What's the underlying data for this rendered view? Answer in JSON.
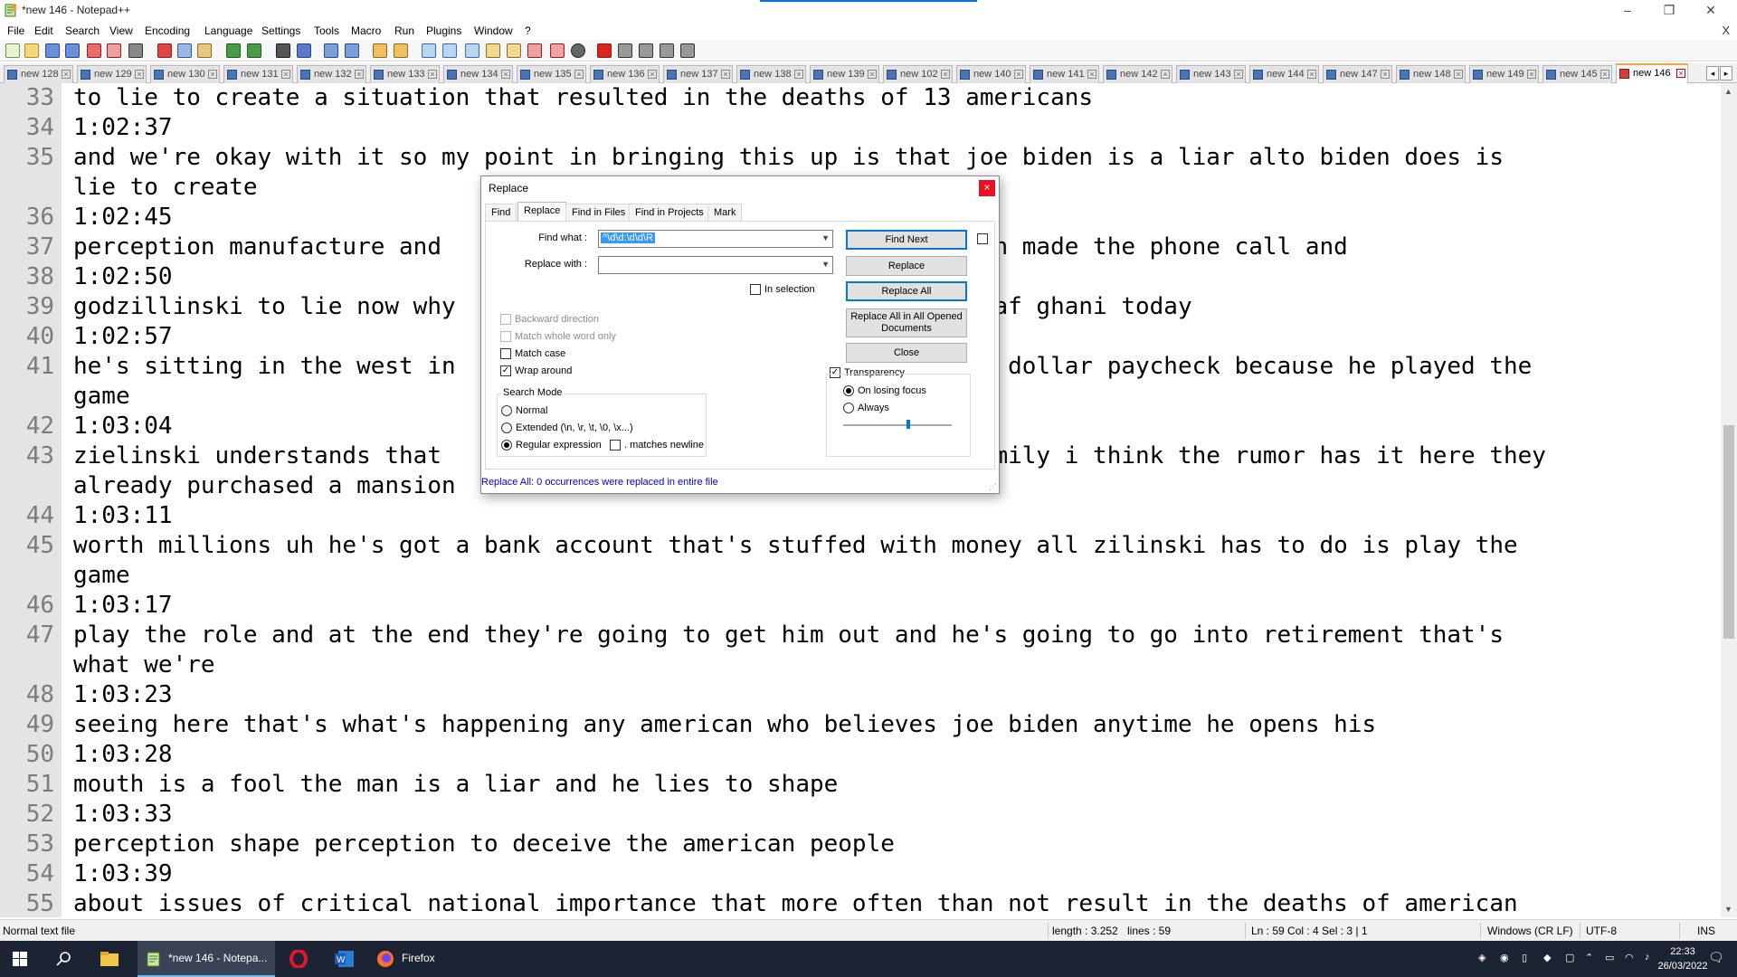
{
  "window": {
    "title": "*new 146 - Notepad++"
  },
  "menu": [
    "File",
    "Edit",
    "Search",
    "View",
    "Encoding",
    "Language",
    "Settings",
    "Tools",
    "Macro",
    "Run",
    "Plugins",
    "Window",
    "?"
  ],
  "menu_close": "X",
  "tabs": [
    "new 128",
    "new 129",
    "new 130",
    "new 131",
    "new 132",
    "new 133",
    "new 134",
    "new 135",
    "new 136",
    "new 137",
    "new 138",
    "new 139",
    "new 102",
    "new 140",
    "new 141",
    "new 142",
    "new 143",
    "new 144",
    "new 147",
    "new 148",
    "new 149",
    "new 145",
    "new 146"
  ],
  "active_tab": "new 146",
  "editor_lines": [
    {
      "num": "33",
      "text": "to lie to create a situation that resulted in the deaths of 13 americans"
    },
    {
      "num": "34",
      "text": "1:02:37"
    },
    {
      "num": "35",
      "text": "and we're okay with it so my point in bringing this up is that joe biden is a liar alto biden does is"
    },
    {
      "num": "",
      "text": "lie to create"
    },
    {
      "num": "36",
      "text": "1:02:45"
    },
    {
      "num": "37",
      "text": "perception manufacture and                                   biden made the phone call and"
    },
    {
      "num": "38",
      "text": "1:02:50"
    },
    {
      "num": "39",
      "text": "godzillinski to lie now why                                  ashraf ghani today"
    },
    {
      "num": "40",
      "text": "1:02:57"
    },
    {
      "num": "41",
      "text": "he's sitting in the west in                                  lion dollar paycheck because he played the"
    },
    {
      "num": "",
      "text": "game"
    },
    {
      "num": "42",
      "text": "1:03:04"
    },
    {
      "num": "43",
      "text": "zielinski understands that                                   s family i think the rumor has it here they"
    },
    {
      "num": "",
      "text": "already purchased a mansion"
    },
    {
      "num": "44",
      "text": "1:03:11"
    },
    {
      "num": "45",
      "text": "worth millions uh he's got a bank account that's stuffed with money all zilinski has to do is play the"
    },
    {
      "num": "",
      "text": "game"
    },
    {
      "num": "46",
      "text": "1:03:17"
    },
    {
      "num": "47",
      "text": "play the role and at the end they're going to get him out and he's going to go into retirement that's"
    },
    {
      "num": "",
      "text": "what we're"
    },
    {
      "num": "48",
      "text": "1:03:23"
    },
    {
      "num": "49",
      "text": "seeing here that's what's happening any american who believes joe biden anytime he opens his"
    },
    {
      "num": "50",
      "text": "1:03:28"
    },
    {
      "num": "51",
      "text": "mouth is a fool the man is a liar and he lies to shape"
    },
    {
      "num": "52",
      "text": "1:03:33"
    },
    {
      "num": "53",
      "text": "perception shape perception to deceive the american people"
    },
    {
      "num": "54",
      "text": "1:03:39"
    },
    {
      "num": "55",
      "text": "about issues of critical national importance that more often than not result in the deaths of american"
    }
  ],
  "dialog": {
    "title": "Replace",
    "close": "×",
    "tabs": [
      "Find",
      "Replace",
      "Find in Files",
      "Find in Projects",
      "Mark"
    ],
    "active_tab": "Replace",
    "find_what_label": "Find what :",
    "find_what_value": "^\\d\\d:\\d\\d\\R",
    "replace_with_label": "Replace with :",
    "replace_with_value": "",
    "in_selection": "In selection",
    "buttons": {
      "find_next": "Find Next",
      "replace": "Replace",
      "replace_all": "Replace All",
      "replace_all_opened": "Replace All in All Opened Documents",
      "close": "Close"
    },
    "options": {
      "backward": "Backward direction",
      "whole_word": "Match whole word only",
      "match_case": "Match case",
      "wrap_around": "Wrap around"
    },
    "search_mode": {
      "title": "Search Mode",
      "normal": "Normal",
      "extended": "Extended (\\n, \\r, \\t, \\0, \\x...)",
      "regex": "Regular expression",
      "matches_newline": ". matches newline"
    },
    "transparency": {
      "title": "Transparency",
      "on_losing_focus": "On losing focus",
      "always": "Always",
      "level": 0.6
    },
    "status_message": "Replace All: 0 occurrences were replaced in entire file"
  },
  "statusbar": {
    "file_type": "Normal text file",
    "length": "length : 3.252",
    "lines": "lines : 59",
    "position": "Ln : 59   Col : 4   Sel : 3 | 1",
    "eol": "Windows (CR LF)",
    "encoding": "UTF-8",
    "mode": "INS"
  },
  "taskbar": {
    "notepad_label": "*new 146 - Notepa...",
    "firefox_label": "Firefox",
    "time": "22:33",
    "date": "26/03/2022"
  }
}
